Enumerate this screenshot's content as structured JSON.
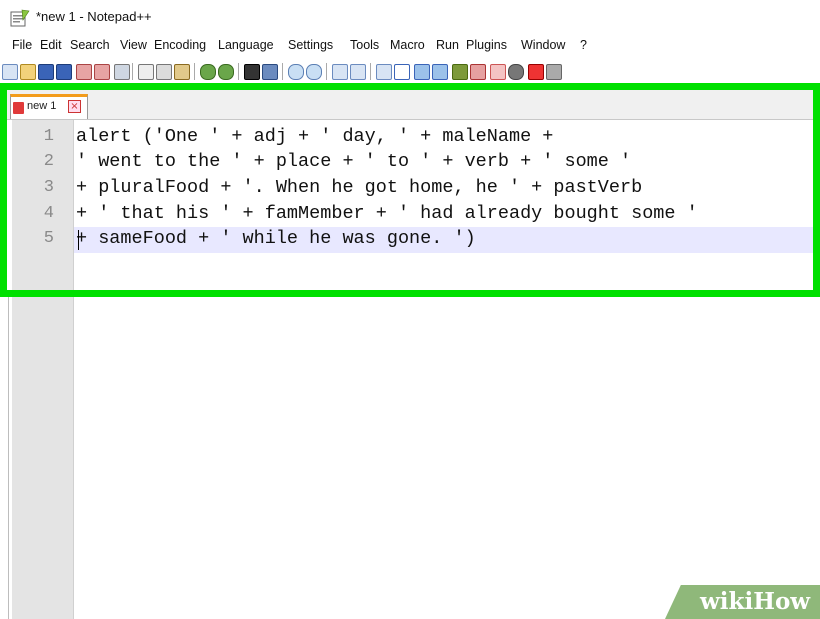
{
  "window": {
    "title": "*new 1 - Notepad++"
  },
  "menu": [
    "File",
    "Edit",
    "Search",
    "View",
    "Encoding",
    "Language",
    "Settings",
    "Tools",
    "Macro",
    "Run",
    "Plugins",
    "Window",
    "?"
  ],
  "tab": {
    "label": "new 1",
    "close_glyph": "×"
  },
  "editor": {
    "lines": [
      {
        "num": "1",
        "text": "alert ('One ' + adj + ' day, ' + maleName +"
      },
      {
        "num": "2",
        "text": "' went to the ' + place + ' to ' + verb + ' some '"
      },
      {
        "num": "3",
        "text": "+ pluralFood + '. When he got home, he ' + pastVerb"
      },
      {
        "num": "4",
        "text": "+ ' that his ' + famMember + ' had already bought some '"
      },
      {
        "num": "5",
        "text": "+ sameFood + ' while he was gone. ')"
      }
    ]
  },
  "watermark": {
    "text": "wikiHow"
  },
  "colors": {
    "highlight_frame": "#00e000",
    "current_line": "#e8e8ff",
    "tab_accent": "#f39c1c"
  }
}
